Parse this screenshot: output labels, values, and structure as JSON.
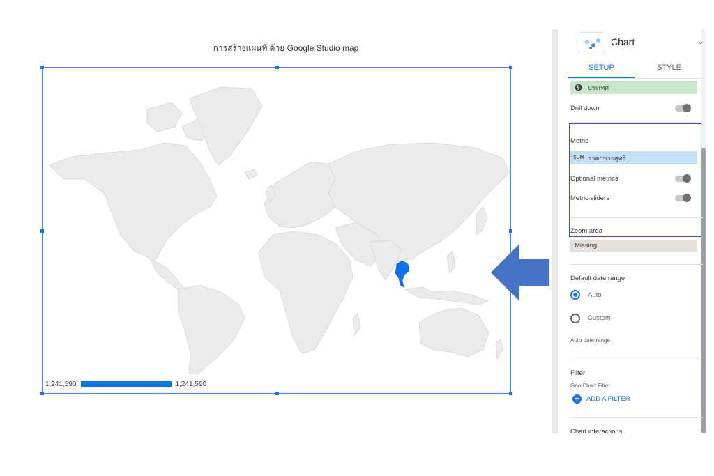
{
  "report": {
    "title": "การสร้างแผนที่ ด้วย Google Studio map",
    "legend_min": "1,241,590",
    "legend_max": "1,241,590",
    "highlight_color": "#0b72e8",
    "land_color": "#ebebeb"
  },
  "panel": {
    "chart_type_label": "Chart",
    "tabs": [
      "SETUP",
      "STYLE"
    ],
    "active_tab": "SETUP",
    "dimension": {
      "icon": "globe-icon",
      "label": "ประเทศ"
    },
    "drill_down": "Drill down",
    "metric": {
      "section_label": "Metric",
      "aggregation": "SUM",
      "field": "ราคาขายสุทธิ",
      "optional_metrics": "Optional metrics",
      "metric_sliders": "Metric sliders"
    },
    "zoom_area": {
      "label": "Zoom area",
      "value": "Missing"
    },
    "date_range": {
      "label": "Default date range",
      "options": [
        "Auto",
        "Custom"
      ],
      "selected": "Auto",
      "hint": "Auto date range"
    },
    "filter": {
      "label": "Filter",
      "sub_label": "Geo Chart Filter",
      "add_label": "ADD A FILTER"
    },
    "chart_interactions": "Chart interactions"
  }
}
